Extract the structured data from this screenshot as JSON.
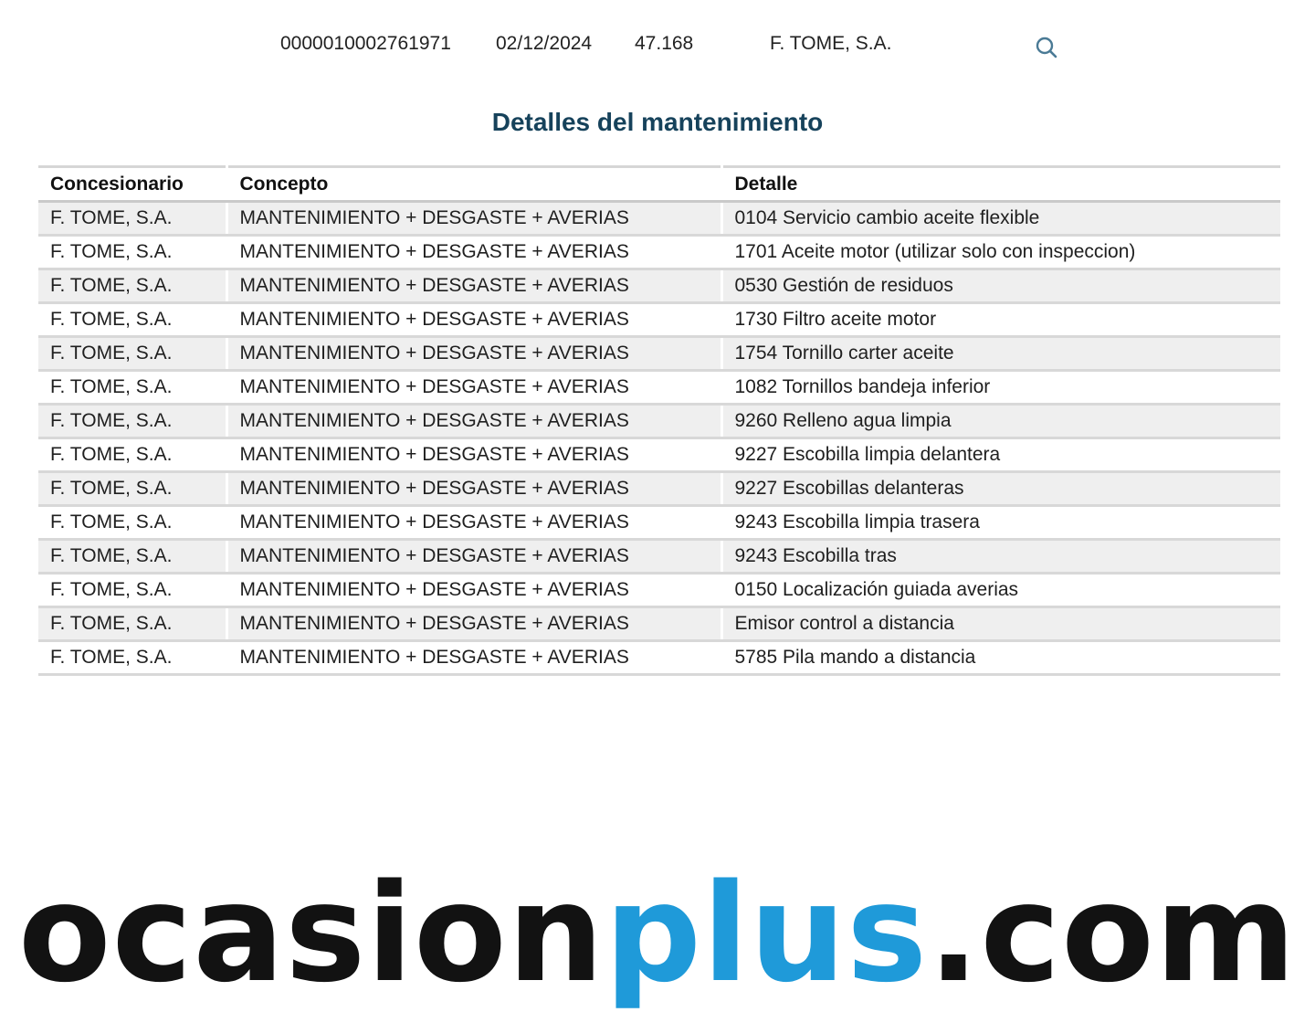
{
  "summary": {
    "id": "0000010002761971",
    "date": "02/12/2024",
    "km": "47.168",
    "dealer": "F. TOME, S.A.",
    "search_icon": "search-icon"
  },
  "title": "Detalles del mantenimiento",
  "table": {
    "headers": [
      "Concesionario",
      "Concepto",
      "Detalle"
    ],
    "rows": [
      [
        "F. TOME, S.A.",
        "MANTENIMIENTO + DESGASTE + AVERIAS",
        "0104 Servicio cambio aceite flexible"
      ],
      [
        "F. TOME, S.A.",
        "MANTENIMIENTO + DESGASTE + AVERIAS",
        "1701 Aceite motor (utilizar solo con inspeccion)"
      ],
      [
        "F. TOME, S.A.",
        "MANTENIMIENTO + DESGASTE + AVERIAS",
        "0530 Gestión de residuos"
      ],
      [
        "F. TOME, S.A.",
        "MANTENIMIENTO + DESGASTE + AVERIAS",
        "1730 Filtro aceite motor"
      ],
      [
        "F. TOME, S.A.",
        "MANTENIMIENTO + DESGASTE + AVERIAS",
        "1754 Tornillo carter aceite"
      ],
      [
        "F. TOME, S.A.",
        "MANTENIMIENTO + DESGASTE + AVERIAS",
        "1082 Tornillos bandeja inferior"
      ],
      [
        "F. TOME, S.A.",
        "MANTENIMIENTO + DESGASTE + AVERIAS",
        "9260 Relleno agua limpia"
      ],
      [
        "F. TOME, S.A.",
        "MANTENIMIENTO + DESGASTE + AVERIAS",
        "9227 Escobilla limpia delantera"
      ],
      [
        "F. TOME, S.A.",
        "MANTENIMIENTO + DESGASTE + AVERIAS",
        "9227 Escobillas delanteras"
      ],
      [
        "F. TOME, S.A.",
        "MANTENIMIENTO + DESGASTE + AVERIAS",
        "9243 Escobilla limpia trasera"
      ],
      [
        "F. TOME, S.A.",
        "MANTENIMIENTO + DESGASTE + AVERIAS",
        "9243 Escobilla tras"
      ],
      [
        "F. TOME, S.A.",
        "MANTENIMIENTO + DESGASTE + AVERIAS",
        "0150 Localización guiada averias"
      ],
      [
        "F. TOME, S.A.",
        "MANTENIMIENTO + DESGASTE + AVERIAS",
        "Emisor control a distancia"
      ],
      [
        "F. TOME, S.A.",
        "MANTENIMIENTO + DESGASTE + AVERIAS",
        "5785 Pila mando a distancia"
      ]
    ]
  },
  "logo": {
    "part1": "ocasion",
    "part2": "plus",
    "part3": ".com",
    "dark_color": "#121212",
    "blue_color": "#1f9ad9"
  },
  "colors": {
    "title": "#16425b",
    "row_alt": "#efefef",
    "icon": "#4a7a95"
  }
}
